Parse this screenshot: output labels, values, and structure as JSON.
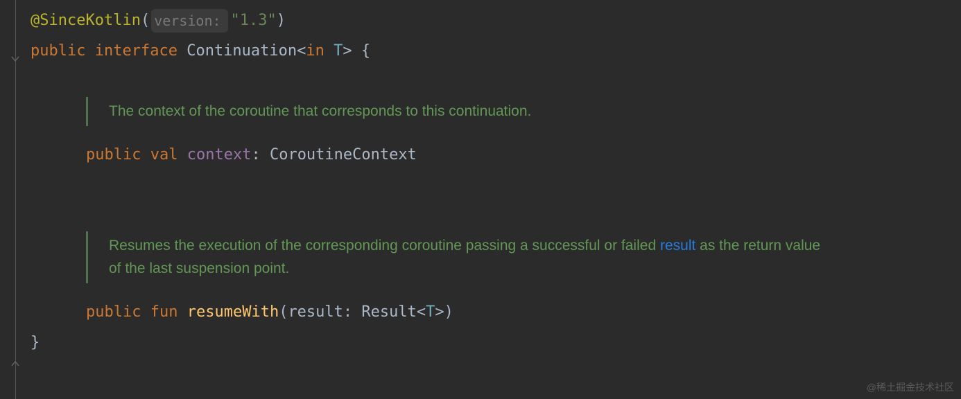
{
  "code": {
    "annotation": "@SinceKotlin",
    "param_hint": "version:",
    "version_string": "\"1.3\"",
    "decl": {
      "public": "public",
      "interface": "interface",
      "name": "Continuation",
      "in": "in",
      "type_param": "T",
      "brace_open": "{",
      "brace_close": "}"
    },
    "doc1": "The context of the coroutine that corresponds to this continuation.",
    "prop": {
      "public": "public",
      "val": "val",
      "name": "context",
      "type": "CoroutineContext"
    },
    "doc2_pre": "Resumes the execution of the corresponding coroutine passing a successful or failed ",
    "doc2_link": "result",
    "doc2_post": " as the return value of the last suspension point.",
    "fun": {
      "public": "public",
      "fun": "fun",
      "name": "resumeWith",
      "param_name": "result",
      "param_type": "Result",
      "param_type_arg": "T"
    }
  },
  "watermark": "@稀土掘金技术社区"
}
